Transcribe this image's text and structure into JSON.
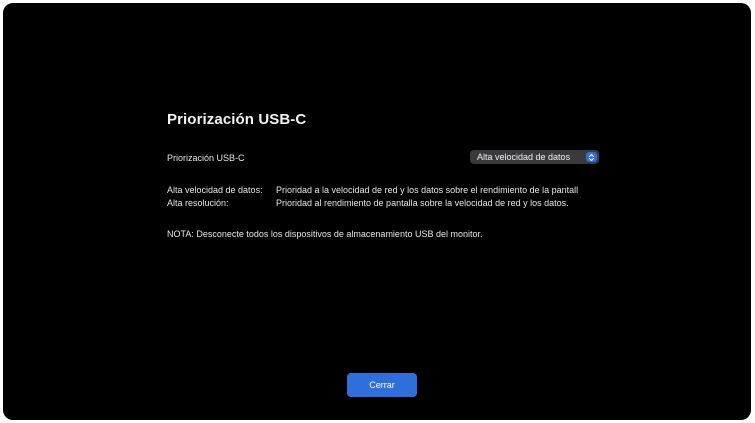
{
  "dialog": {
    "title": "Priorización USB-C",
    "setting_label": "Priorización USB-C",
    "dropdown": {
      "selected": "Alta velocidad de datos",
      "icon": "chevron-updown-icon",
      "accent_color": "#2f6fdb"
    },
    "descriptions": [
      {
        "key": "Alta velocidad de datos:",
        "value": "Prioridad a la velocidad de red y los datos sobre el rendimiento de la pantall"
      },
      {
        "key": "Alta resolución:",
        "value": "Prioridad al rendimiento de pantalla sobre la velocidad de red y los datos."
      }
    ],
    "note": "NOTA: Desconecte todos los dispositivos de almacenamiento USB del monitor.",
    "close_button": "Cerrar"
  }
}
